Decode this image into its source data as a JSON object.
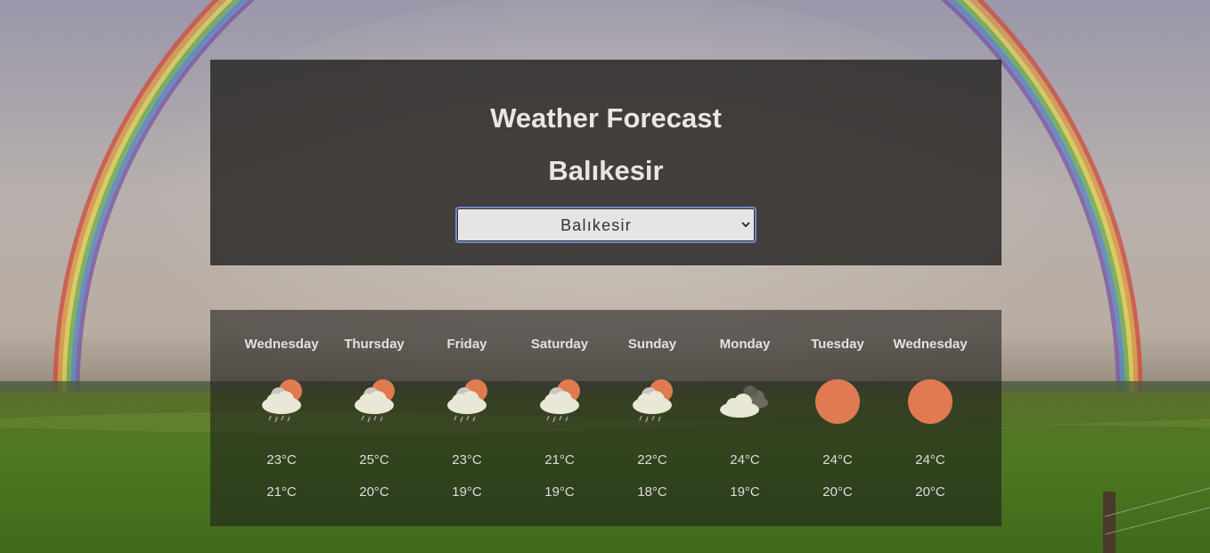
{
  "page": {
    "title": "Weather Forecast",
    "city": "Balıkesir"
  },
  "city_select": {
    "selected": "Balıkesir"
  },
  "colors": {
    "panel": "#28262 4",
    "sun": "#e07a50",
    "cloud": "#e9e7d6"
  },
  "forecast": [
    {
      "day": "Wednesday",
      "high": "23°C",
      "low": "21°C",
      "icon": "rain-sun-icon"
    },
    {
      "day": "Thursday",
      "high": "25°C",
      "low": "20°C",
      "icon": "rain-sun-icon"
    },
    {
      "day": "Friday",
      "high": "23°C",
      "low": "19°C",
      "icon": "rain-sun-icon"
    },
    {
      "day": "Saturday",
      "high": "21°C",
      "low": "19°C",
      "icon": "rain-sun-icon"
    },
    {
      "day": "Sunday",
      "high": "22°C",
      "low": "18°C",
      "icon": "rain-sun-icon"
    },
    {
      "day": "Monday",
      "high": "24°C",
      "low": "19°C",
      "icon": "cloudy-icon"
    },
    {
      "day": "Tuesday",
      "high": "24°C",
      "low": "20°C",
      "icon": "sun-icon"
    },
    {
      "day": "Wednesday",
      "high": "24°C",
      "low": "20°C",
      "icon": "sun-icon"
    }
  ]
}
